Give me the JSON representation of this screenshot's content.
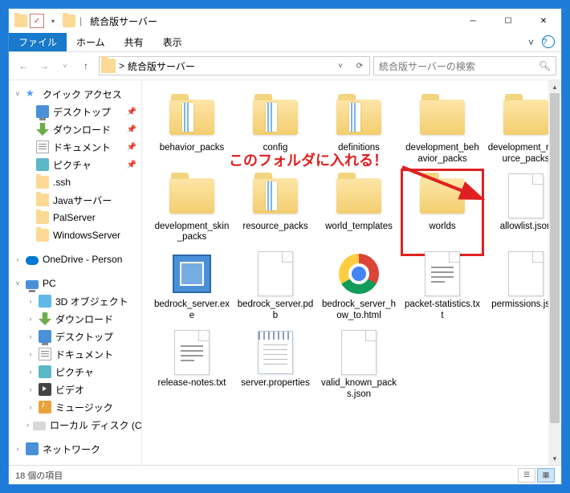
{
  "window": {
    "title": "統合版サーバー",
    "divider": "|"
  },
  "ribbon": {
    "file": "ファイル",
    "home": "ホーム",
    "share": "共有",
    "view": "表示"
  },
  "nav": {
    "address_prefix": "> ",
    "address": "統合版サーバー",
    "search_placeholder": "統合版サーバーの検索"
  },
  "sidebar": {
    "quick_access": "クイック アクセス",
    "quick_items": [
      {
        "label": "デスクトップ",
        "icon": "desktop",
        "pinned": true
      },
      {
        "label": "ダウンロード",
        "icon": "download",
        "pinned": true
      },
      {
        "label": "ドキュメント",
        "icon": "doc",
        "pinned": true
      },
      {
        "label": "ピクチャ",
        "icon": "pic",
        "pinned": true
      },
      {
        "label": ".ssh",
        "icon": "folder",
        "pinned": false
      },
      {
        "label": "Javaサーバー",
        "icon": "folder",
        "pinned": false
      },
      {
        "label": "PalServer",
        "icon": "folder",
        "pinned": false
      },
      {
        "label": "WindowsServer",
        "icon": "folder",
        "pinned": false
      }
    ],
    "onedrive": "OneDrive - Person",
    "pc": "PC",
    "pc_items": [
      {
        "label": "3D オブジェクト",
        "icon": "3d"
      },
      {
        "label": "ダウンロード",
        "icon": "download"
      },
      {
        "label": "デスクトップ",
        "icon": "desktop"
      },
      {
        "label": "ドキュメント",
        "icon": "doc"
      },
      {
        "label": "ピクチャ",
        "icon": "pic"
      },
      {
        "label": "ビデオ",
        "icon": "video"
      },
      {
        "label": "ミュージック",
        "icon": "music"
      },
      {
        "label": "ローカル ディスク (C",
        "icon": "disk"
      }
    ],
    "network": "ネットワーク"
  },
  "items": [
    {
      "name": "behavior_packs",
      "type": "folder-content"
    },
    {
      "name": "config",
      "type": "folder-content"
    },
    {
      "name": "definitions",
      "type": "folder-content"
    },
    {
      "name": "development_behavior_packs",
      "type": "folder"
    },
    {
      "name": "development_resource_packs",
      "type": "folder"
    },
    {
      "name": "development_skin_packs",
      "type": "folder"
    },
    {
      "name": "resource_packs",
      "type": "folder-content"
    },
    {
      "name": "world_templates",
      "type": "folder"
    },
    {
      "name": "worlds",
      "type": "folder",
      "highlighted": true
    },
    {
      "name": "allowlist.json",
      "type": "file"
    },
    {
      "name": "bedrock_server.exe",
      "type": "exe"
    },
    {
      "name": "bedrock_server.pdb",
      "type": "file"
    },
    {
      "name": "bedrock_server_how_to.html",
      "type": "chrome"
    },
    {
      "name": "packet-statistics.txt",
      "type": "txt"
    },
    {
      "name": "permissions.json",
      "type": "file"
    },
    {
      "name": "release-notes.txt",
      "type": "txt"
    },
    {
      "name": "server.properties",
      "type": "notepad"
    },
    {
      "name": "valid_known_packs.json",
      "type": "file"
    }
  ],
  "annotation": {
    "text": "このフォルダに入れる！"
  },
  "statusbar": {
    "count": "18 個の項目"
  }
}
